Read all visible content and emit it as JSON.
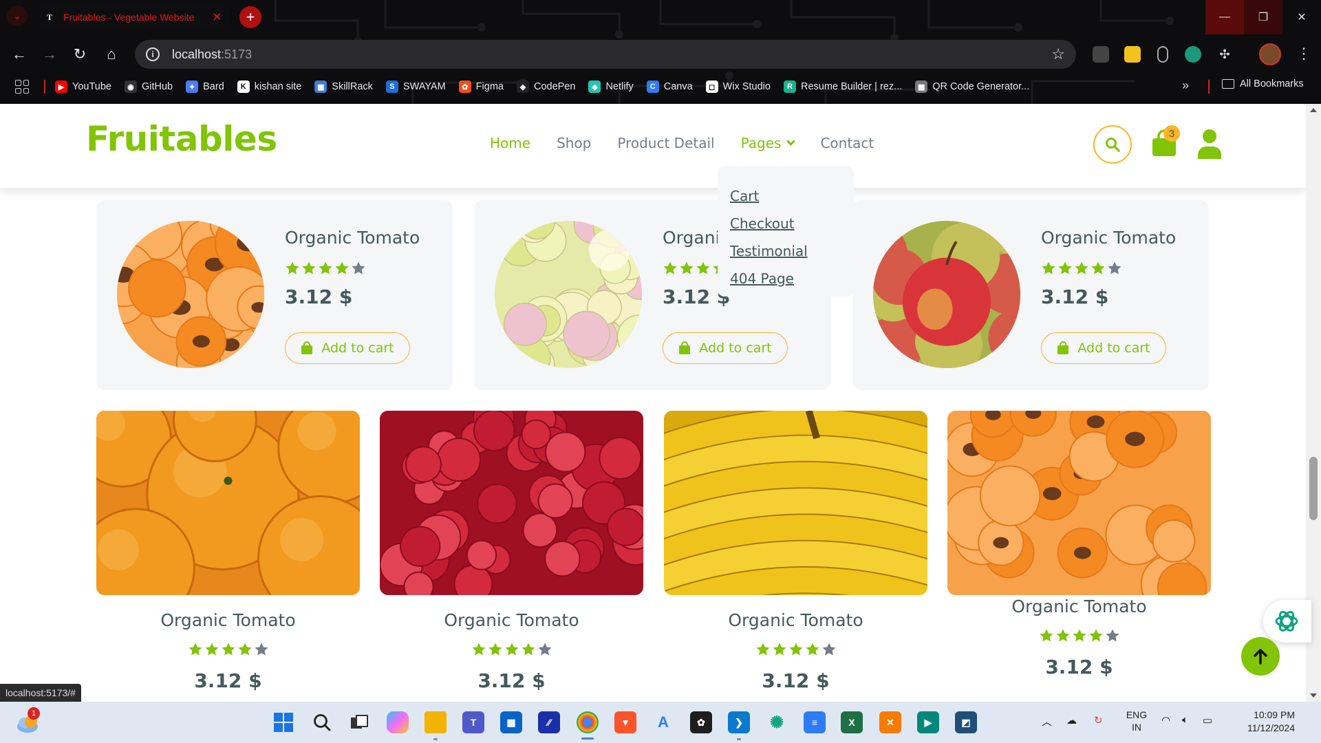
{
  "browser": {
    "tab_title": "Fruitables - Vegetable Website",
    "tab_favicon": "T",
    "url_host": "localhost",
    "url_port": ":5173",
    "bookmarks": [
      {
        "label": "YouTube",
        "icon": "youtube-icon",
        "color": "#ff0000",
        "glyph": "▶"
      },
      {
        "label": "GitHub",
        "icon": "github-icon",
        "color": "#333333",
        "glyph": "◉"
      },
      {
        "label": "Bard",
        "icon": "bard-icon",
        "color": "#4a7cf0",
        "glyph": "✦"
      },
      {
        "label": "kishan site",
        "icon": "kishan-site-icon",
        "color": "#ffffff",
        "glyph": "K"
      },
      {
        "label": "SkillRack",
        "icon": "skillrack-icon",
        "color": "#3b7dd8",
        "glyph": "▦"
      },
      {
        "label": "SWAYAM",
        "icon": "swayam-icon",
        "color": "#1e6fd8",
        "glyph": "S"
      },
      {
        "label": "Figma",
        "icon": "figma-icon",
        "color": "#f24e1e",
        "glyph": "✿"
      },
      {
        "label": "CodePen",
        "icon": "codepen-icon",
        "color": "#222222",
        "glyph": "◈"
      },
      {
        "label": "Netlify",
        "icon": "netlify-icon",
        "color": "#20c6b7",
        "glyph": "◆"
      },
      {
        "label": "Canva",
        "icon": "canva-icon",
        "color": "#2d7cf6",
        "glyph": "C"
      },
      {
        "label": "Wix Studio",
        "icon": "wix-studio-icon",
        "color": "#ffffff",
        "glyph": "◻"
      },
      {
        "label": "Resume Builder | rez...",
        "icon": "resume-builder-icon",
        "color": "#18b28c",
        "glyph": "R"
      },
      {
        "label": "QR Code Generator...",
        "icon": "qr-code-icon",
        "color": "#777777",
        "glyph": "▩"
      }
    ],
    "all_bookmarks": "All Bookmarks",
    "status_url": "localhost:5173/#"
  },
  "site": {
    "logo": "Fruitables",
    "nav": {
      "home": "Home",
      "shop": "Shop",
      "product_detail": "Product Detail",
      "pages": "Pages",
      "contact": "Contact"
    },
    "cart_count": "3",
    "dropdown": [
      "Cart",
      "Checkout",
      "Testimonial",
      "404 Page"
    ],
    "brand_green": "#81c408",
    "accent_orange": "#ffb524",
    "text_dark": "#45595b"
  },
  "top_products": [
    {
      "title": "Organic Tomato",
      "rating": 4,
      "price": "3.12 $",
      "button": "Add to cart",
      "image": "apricots"
    },
    {
      "title": "Organic Tomato",
      "rating": 4,
      "price": "3.12 $",
      "button": "Add to cart",
      "image": "grapes"
    },
    {
      "title": "Organic Tomato",
      "rating": 4,
      "price": "3.12 $",
      "button": "Add to cart",
      "image": "apple"
    }
  ],
  "grid_products": [
    {
      "title": "Organic Tomato",
      "rating": 4,
      "price": "3.12 $",
      "image": "oranges"
    },
    {
      "title": "Organic Tomato",
      "rating": 4,
      "price": "3.12 $",
      "image": "raspberries"
    },
    {
      "title": "Organic Tomato",
      "rating": 4,
      "price": "3.12 $",
      "image": "bananas"
    },
    {
      "title": "Organic Tomato",
      "rating": 4,
      "price": "3.12 $",
      "image": "apricots"
    }
  ],
  "taskbar": {
    "weather_badge": "1",
    "lang_line1": "ENG",
    "lang_line2": "IN",
    "time": "10:09 PM",
    "date": "11/12/2024"
  }
}
